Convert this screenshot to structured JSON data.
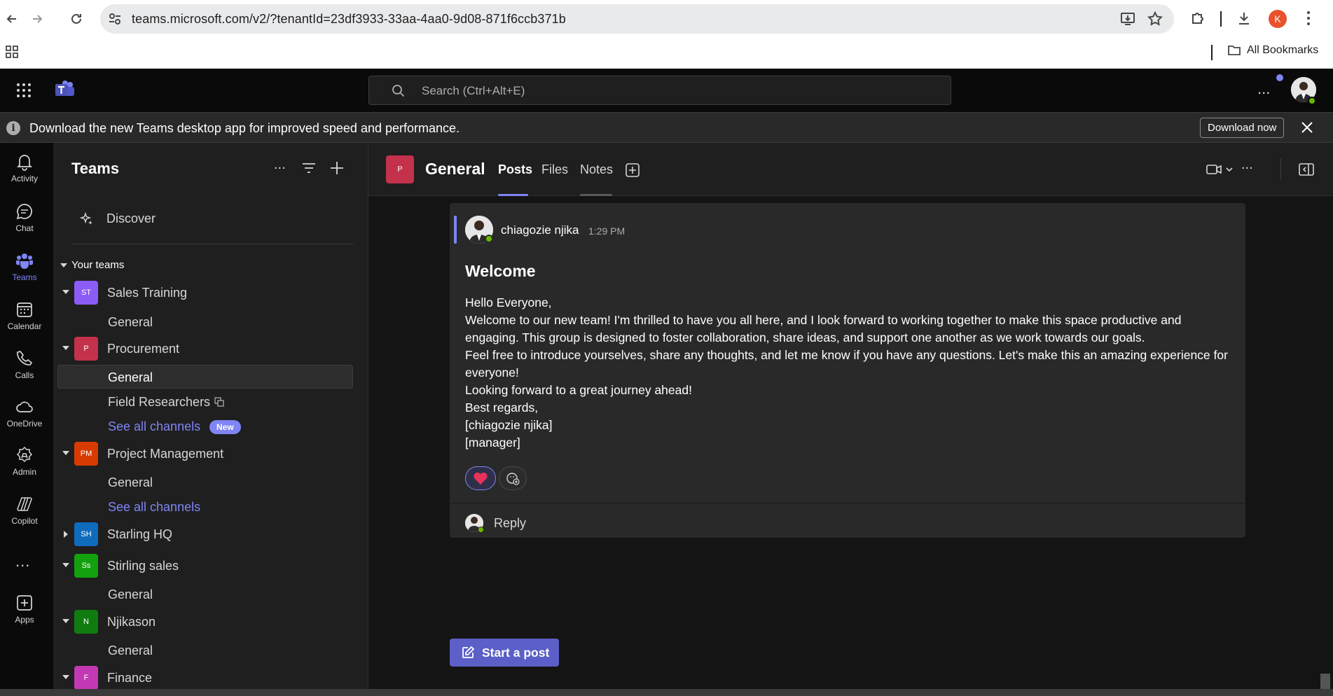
{
  "browser": {
    "url": "teams.microsoft.com/v2/?tenantId=23df3933-33aa-4aa0-9d08-871f6ccb371b",
    "profile_initial": "K",
    "bookmarks_label": "All Bookmarks"
  },
  "header": {
    "search_placeholder": "Search (Ctrl+Alt+E)",
    "more_label": "..."
  },
  "banner": {
    "info_glyph": "i",
    "message": "Download the new Teams desktop app for improved speed and performance.",
    "download_label": "Download now"
  },
  "rail": {
    "items": [
      {
        "label": "Activity",
        "icon": "bell-icon"
      },
      {
        "label": "Chat",
        "icon": "chat-icon"
      },
      {
        "label": "Teams",
        "icon": "teams-icon"
      },
      {
        "label": "Calendar",
        "icon": "calendar-icon"
      },
      {
        "label": "Calls",
        "icon": "phone-icon"
      },
      {
        "label": "OneDrive",
        "icon": "cloud-icon"
      },
      {
        "label": "Admin",
        "icon": "admin-icon"
      },
      {
        "label": "Copilot",
        "icon": "copilot-icon"
      },
      {
        "label": "Apps",
        "icon": "add-app-icon"
      }
    ],
    "more_label": "...",
    "active": "Teams"
  },
  "teams_panel": {
    "title": "Teams",
    "more_label": "...",
    "discover_label": "Discover",
    "your_teams_label": "Your teams",
    "teams": [
      {
        "initials": "ST",
        "name": "Sales Training",
        "color": "#8b5cf6",
        "channels": [
          "General"
        ]
      },
      {
        "initials": "P",
        "name": "Procurement",
        "color": "#c4314b",
        "channels": [
          "General",
          "Field Researchers"
        ],
        "see_all": "See all channels",
        "badge": "New"
      },
      {
        "initials": "PM",
        "name": "Project Management",
        "color": "#d83b01",
        "channels": [
          "General"
        ],
        "see_all": "See all channels"
      },
      {
        "initials": "SH",
        "name": "Starling HQ",
        "color": "#0f6cbd",
        "channels": []
      },
      {
        "initials": "Ss",
        "name": "Stirling sales",
        "color": "#13a10e",
        "channels": [
          "General"
        ]
      },
      {
        "initials": "N",
        "name": "Njikason",
        "color": "#107c10",
        "channels": [
          "General"
        ]
      },
      {
        "initials": "F",
        "name": "Finance",
        "color": "#c239b3",
        "channels": []
      }
    ]
  },
  "channel": {
    "avatar_initial": "P",
    "name": "General",
    "tabs": [
      "Posts",
      "Files",
      "Notes"
    ],
    "active_tab": "Posts",
    "more_label": "..."
  },
  "post": {
    "author": "chiagozie njika",
    "time": "1:29 PM",
    "subject": "Welcome",
    "body_lines": [
      "Hello Everyone,",
      "Welcome to our new team! I'm thrilled to have you all here, and I look forward to working together to make this space productive and engaging. This group is designed to foster collaboration, share ideas, and support one another as we work towards our goals.",
      "Feel free to introduce yourselves, share any thoughts, and let me know if you have any questions. Let's make this an amazing experience for everyone!",
      "Looking forward to a great journey ahead!",
      "Best regards,",
      "[chiagozie njika]",
      "[manager]"
    ],
    "reply_label": "Reply"
  },
  "start_post_label": "Start a post",
  "colors": {
    "accent": "#7f85f5",
    "brand_button": "#5b5fc7",
    "presence_available": "#6bb700"
  }
}
